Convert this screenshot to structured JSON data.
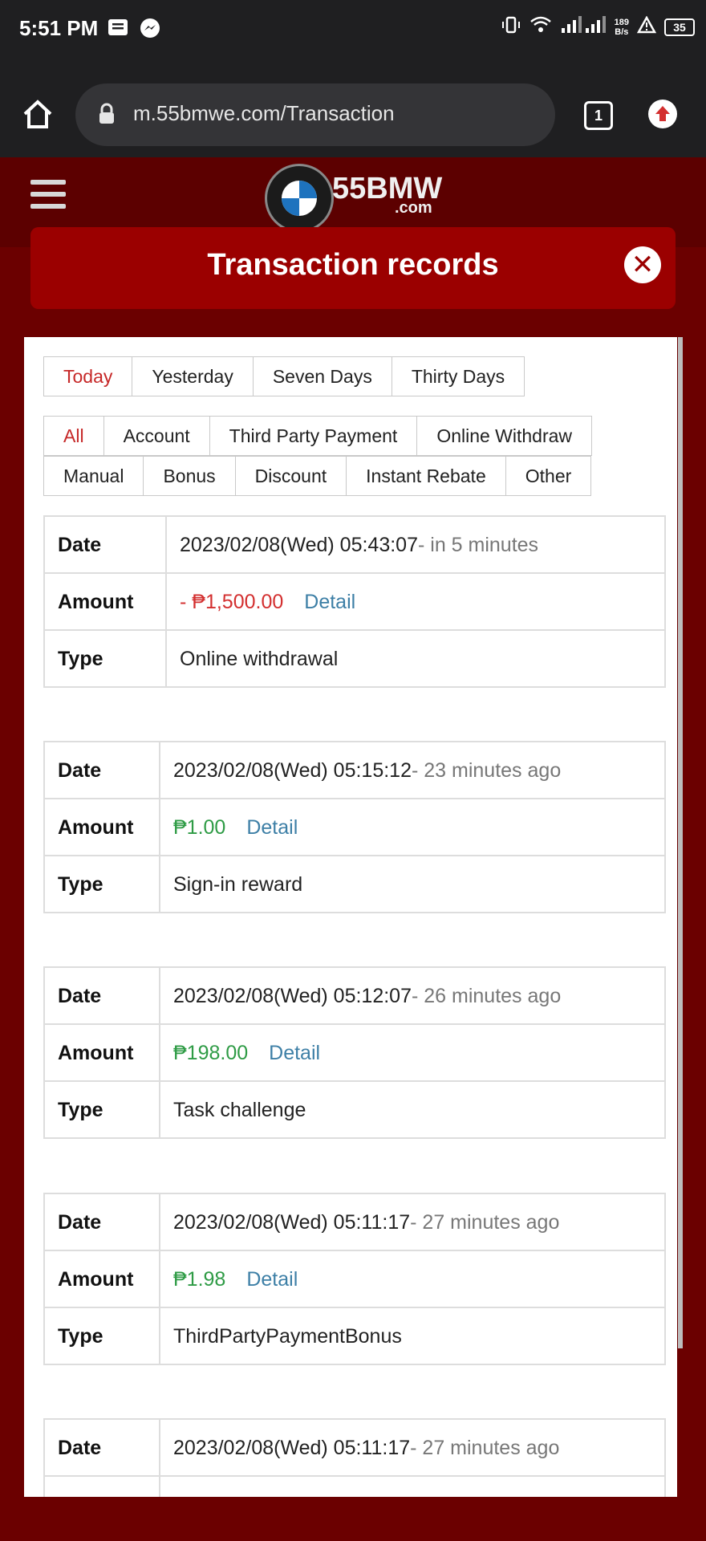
{
  "status_bar": {
    "time": "5:51 PM",
    "net_speed_value": "189",
    "net_speed_unit": "B/s",
    "battery": "35"
  },
  "browser": {
    "url": "m.55bmwe.com/Transaction",
    "tab_count": "1"
  },
  "site": {
    "logo_text": "55BMW",
    "logo_sub": ".com"
  },
  "modal": {
    "title": "Transaction records"
  },
  "date_filters": [
    {
      "label": "Today",
      "active": true
    },
    {
      "label": "Yesterday",
      "active": false
    },
    {
      "label": "Seven Days",
      "active": false
    },
    {
      "label": "Thirty Days",
      "active": false
    }
  ],
  "type_filters_row1": [
    {
      "label": "All",
      "active": true
    },
    {
      "label": "Account",
      "active": false
    },
    {
      "label": "Third Party Payment",
      "active": false
    },
    {
      "label": "Online Withdraw",
      "active": false
    }
  ],
  "type_filters_row2": [
    {
      "label": "Manual",
      "active": false
    },
    {
      "label": "Bonus",
      "active": false
    },
    {
      "label": "Discount",
      "active": false
    },
    {
      "label": "Instant Rebate",
      "active": false
    },
    {
      "label": "Other",
      "active": false
    }
  ],
  "field_labels": {
    "date": "Date",
    "amount": "Amount",
    "type": "Type",
    "detail": "Detail"
  },
  "records": [
    {
      "date": "2023/02/08(Wed) 05:43:07",
      "relative": "- in 5 minutes",
      "amount": "- ₱1,500.00",
      "sign": "neg",
      "type": "Online withdrawal"
    },
    {
      "date": "2023/02/08(Wed) 05:15:12",
      "relative": "- 23 minutes ago",
      "amount": "₱1.00",
      "sign": "pos",
      "type": "Sign-in reward"
    },
    {
      "date": "2023/02/08(Wed) 05:12:07",
      "relative": "- 26 minutes ago",
      "amount": "₱198.00",
      "sign": "pos",
      "type": "Task challenge"
    },
    {
      "date": "2023/02/08(Wed) 05:11:17",
      "relative": "- 27 minutes ago",
      "amount": "₱1.98",
      "sign": "pos",
      "type": "ThirdPartyPaymentBonus"
    },
    {
      "date": "2023/02/08(Wed) 05:11:17",
      "relative": "- 27 minutes ago",
      "amount": "",
      "sign": "pos",
      "type": ""
    }
  ]
}
